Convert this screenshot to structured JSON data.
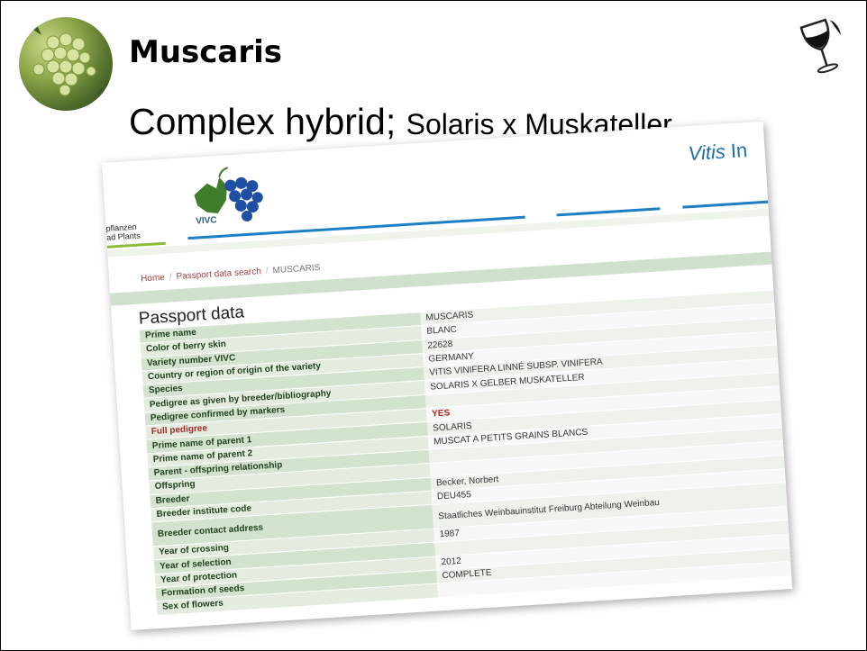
{
  "slide": {
    "title": "Muscaris",
    "subtitle_main": "Complex hybrid; ",
    "subtitle_rest": "Solaris x Muskateller"
  },
  "icons": {
    "grape_photo": "grape-cluster-photo",
    "wine_glass": "wine-glass-icon"
  },
  "screenshot": {
    "header": {
      "left_label_line1": "pflanzen",
      "left_label_line2": "ad Plants",
      "logo_text": "VIVC",
      "site_title_italic": "Vitis",
      "site_title_rest": " In"
    },
    "breadcrumb": {
      "home": "Home",
      "search": "Passport data search",
      "current": "MUSCARIS"
    },
    "heading": "Passport data",
    "rows": [
      {
        "label": "Prime name",
        "value": "MUSCARIS"
      },
      {
        "label": "Color of berry skin",
        "value": "BLANC"
      },
      {
        "label": "Variety number VIVC",
        "value": "22628"
      },
      {
        "label": "Country or region of origin of the variety",
        "value": "GERMANY"
      },
      {
        "label": "Species",
        "value": "VITIS VINIFERA LINNÉ SUBSP. VINIFERA"
      },
      {
        "label": "Pedigree as given by breeder/bibliography",
        "value": "SOLARIS X GELBER MUSKATELLER"
      },
      {
        "label": "Pedigree confirmed by markers",
        "value": ""
      },
      {
        "label": "Full pedigree",
        "value": "YES"
      },
      {
        "label": "Prime name of parent 1",
        "value": "SOLARIS"
      },
      {
        "label": "Prime name of parent 2",
        "value": "MUSCAT A PETITS GRAINS BLANCS"
      },
      {
        "label": "Parent - offspring relationship",
        "value": ""
      },
      {
        "label": "Offspring",
        "value": ""
      },
      {
        "label": "Breeder",
        "value": "Becker, Norbert"
      },
      {
        "label": "Breeder institute code",
        "value": "DEU455"
      },
      {
        "label": "Breeder contact address",
        "value": "Staatliches Weinbauinstitut Freiburg Abteilung Weinbau"
      },
      {
        "label": "Year of crossing",
        "value": "1987"
      },
      {
        "label": "Year of selection",
        "value": ""
      },
      {
        "label": "Year of protection",
        "value": "2012"
      },
      {
        "label": "Formation of seeds",
        "value": "COMPLETE"
      },
      {
        "label": "Sex of flowers",
        "value": ""
      }
    ],
    "colors": {
      "label_bg": "#d3e3cf",
      "value_bg": "#edf3eb",
      "accent_blue": "#1c7ec4",
      "accent_green": "#8dbb3a",
      "highlight_red": "#c02020"
    }
  }
}
